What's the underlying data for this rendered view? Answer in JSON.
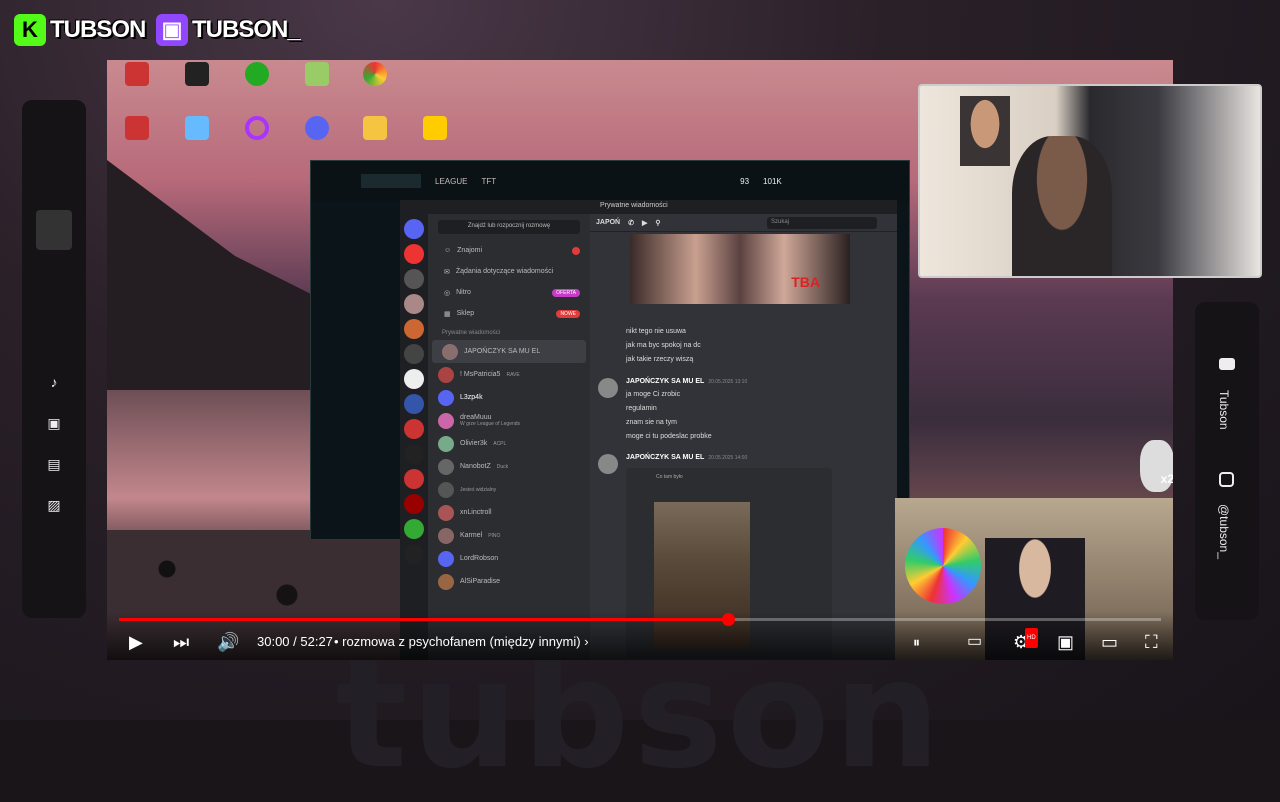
{
  "brands": [
    {
      "platform": "kick",
      "name": "TUBSON",
      "color": "#53fc18"
    },
    {
      "platform": "twitch",
      "name": "TUBSON_",
      "color": "#9146ff"
    }
  ],
  "watermark": "tubson",
  "socials": [
    {
      "icon": "youtube-icon",
      "handle": "Tubson"
    },
    {
      "icon": "instagram-icon",
      "handle": "@tubson_"
    }
  ],
  "left_sidebar": [
    {
      "icon": "music-icon"
    },
    {
      "icon": "video-icon"
    },
    {
      "icon": "calendar-icon"
    },
    {
      "icon": "image-icon"
    }
  ],
  "lol_client": {
    "tabs": [
      "LEAGUE",
      "TFT"
    ],
    "currency": [
      "93",
      "101K"
    ]
  },
  "discord": {
    "title": "Prywatne wiadomości",
    "search_placeholder": "Znajdź lub rozpocznij rozmowę",
    "nav": [
      {
        "label": "Znajomi",
        "badge": ""
      },
      {
        "label": "Żądania dotyczące wiadomości",
        "badge": ""
      },
      {
        "label": "Nitro",
        "badge": "OFERTA"
      },
      {
        "label": "Sklep",
        "badge": "NOWE"
      }
    ],
    "dm_section": "Prywatne wiadomości",
    "dms": [
      {
        "name": "JAPOŃCZYK SA MU EL",
        "tag": ""
      },
      {
        "name": "! MsPatricia5",
        "tag": "RAVE"
      },
      {
        "name": "L3zp4k",
        "tag": ""
      },
      {
        "name": "dreaMuuu",
        "tag": "W grze League of Legends"
      },
      {
        "name": "Olivier3k",
        "tag": "ACPL"
      },
      {
        "name": "NanobotZ",
        "tag": "Duck"
      },
      {
        "name": "",
        "tag": "Jesteś widzialny"
      },
      {
        "name": "xnLinctroll",
        "tag": ""
      },
      {
        "name": "Karmel",
        "tag": "PINO"
      },
      {
        "name": "LordRobson",
        "tag": ""
      },
      {
        "name": "AlSiParadise",
        "tag": ""
      }
    ],
    "chat_header": "JAPOŃ",
    "chat_search": "Szukaj",
    "image_overlay": "TBA",
    "messages_a": [
      "nikt tego nie usuwa",
      "jak ma byc spokoj na dc",
      "jak takie rzeczy wiszą"
    ],
    "author": "JAPOŃCZYK SA MU EL",
    "time1": "20.05.2025 13:10",
    "messages_b": [
      "ja moge Ci zrobic",
      "regulamin",
      "znam sie na tym",
      "moge ci tu podeslac probke"
    ],
    "time2": "20.05.2025 14:00",
    "embed_caption": "Co tam było"
  },
  "player": {
    "time": "30:00 / 52:27",
    "chapter": "• rozmowa z psychofanem (między innymi)",
    "progress": 0.584,
    "hd_badge": "HD"
  },
  "overlay_badge": "x2"
}
